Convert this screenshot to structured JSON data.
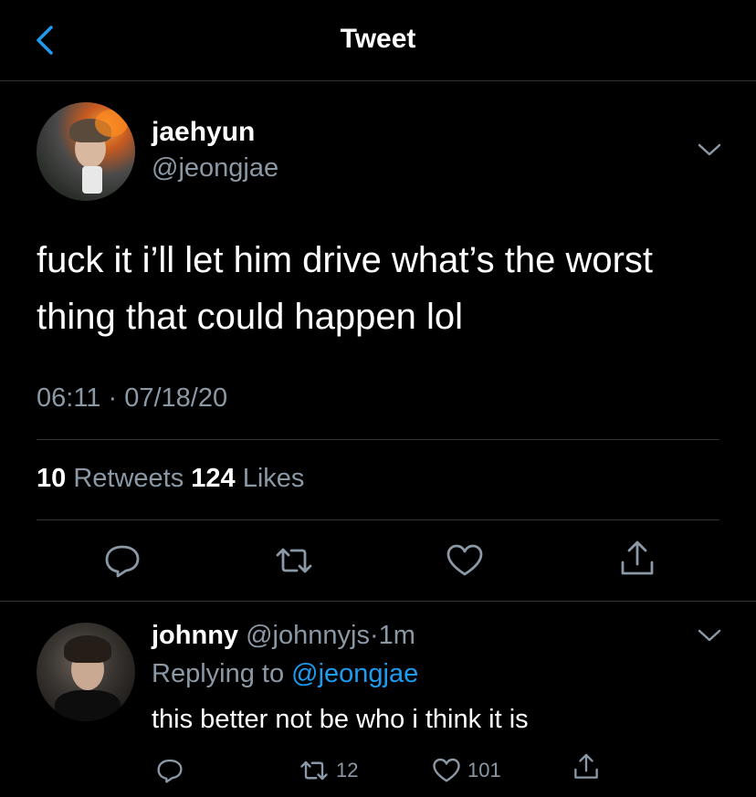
{
  "header": {
    "title": "Tweet",
    "back_icon": "chevron-left-icon"
  },
  "tweet": {
    "author": {
      "display_name": "jaehyun",
      "handle": "@jeongjae"
    },
    "text_line1": "fuck it i’ll let him drive what’s the worst",
    "text_line2": "thing that could happen lol",
    "timestamp": "06:11 · 07/18/20",
    "stats": {
      "retweets_count": "10",
      "retweets_label": "Retweets",
      "likes_count": "124",
      "likes_label": "Likes"
    },
    "actions": [
      "reply-icon",
      "retweet-icon",
      "like-icon",
      "share-icon"
    ]
  },
  "reply": {
    "display_name": "johnny",
    "handle": "@johnnyjs",
    "separator": "·",
    "time": "1m",
    "replying_prefix": "Replying to",
    "replying_mention": "@jeongjae",
    "text": "this better not be who i think it is",
    "retweet_count": "12",
    "like_count": "101"
  },
  "colors": {
    "background": "#000000",
    "text_primary": "#ffffff",
    "text_secondary": "#8b98a5",
    "accent": "#1d9bf0",
    "divider": "#2f3336"
  }
}
